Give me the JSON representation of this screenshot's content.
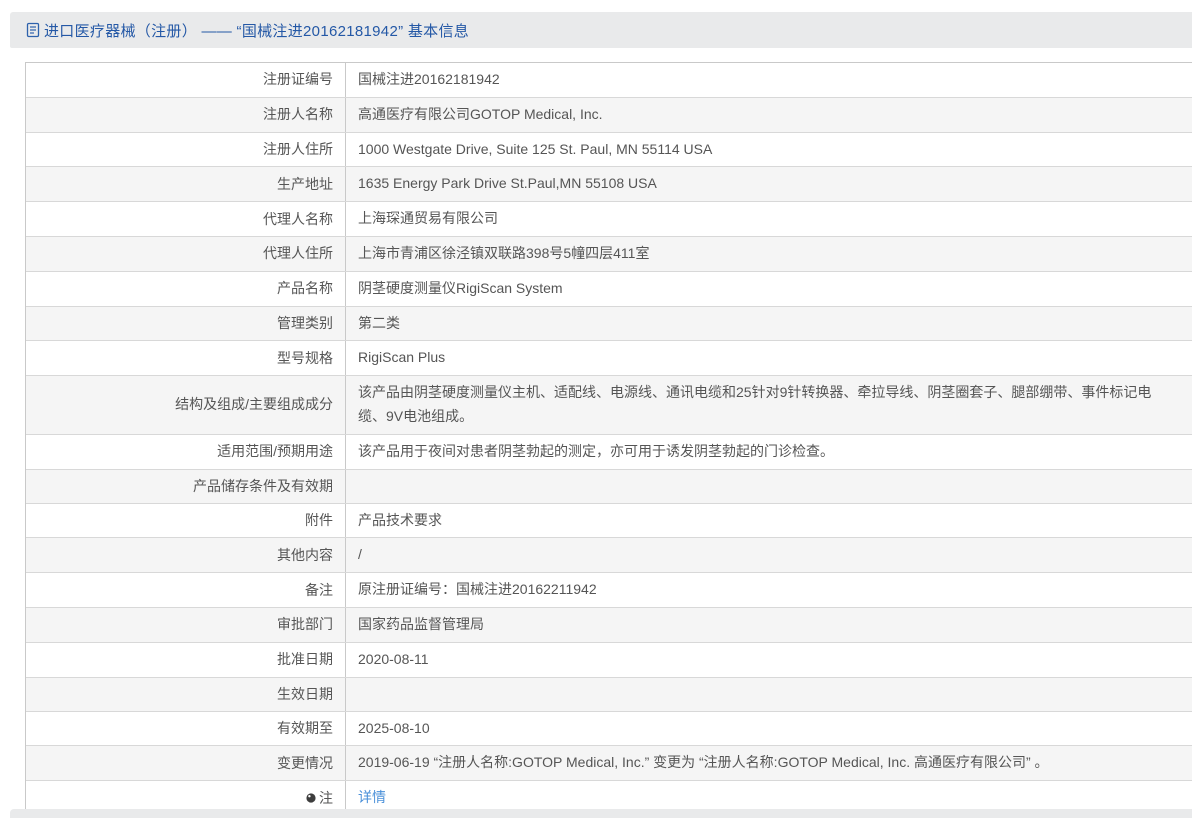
{
  "header": {
    "icon": "document-icon",
    "title": "进口医疗器械（注册） —— “国械注进20162181942” 基本信息"
  },
  "table": {
    "rows": [
      {
        "label": "注册证编号",
        "value": "国械注进20162181942"
      },
      {
        "label": "注册人名称",
        "value": "高通医疗有限公司GOTOP Medical, Inc."
      },
      {
        "label": "注册人住所",
        "value": "1000 Westgate Drive, Suite 125 St. Paul, MN 55114 USA"
      },
      {
        "label": "生产地址",
        "value": "1635 Energy Park Drive St.Paul,MN 55108 USA"
      },
      {
        "label": "代理人名称",
        "value": "上海琛通贸易有限公司"
      },
      {
        "label": "代理人住所",
        "value": "上海市青浦区徐泾镇双联路398号5幢四层411室"
      },
      {
        "label": "产品名称",
        "value": "阴茎硬度测量仪RigiScan System"
      },
      {
        "label": "管理类别",
        "value": "第二类"
      },
      {
        "label": "型号规格",
        "value": "RigiScan Plus"
      },
      {
        "label": "结构及组成/主要组成成分",
        "value": "该产品由阴茎硬度测量仪主机、适配线、电源线、通讯电缆和25针对9针转换器、牵拉导线、阴茎圈套子、腿部绷带、事件标记电缆、9V电池组成。"
      },
      {
        "label": "适用范围/预期用途",
        "value": "该产品用于夜间对患者阴茎勃起的测定，亦可用于诱发阴茎勃起的门诊检查。"
      },
      {
        "label": "产品储存条件及有效期",
        "value": ""
      },
      {
        "label": "附件",
        "value": "产品技术要求"
      },
      {
        "label": "其他内容",
        "value": "/"
      },
      {
        "label": "备注",
        "value": "原注册证编号：国械注进20162211942"
      },
      {
        "label": "审批部门",
        "value": "国家药品监督管理局"
      },
      {
        "label": "批准日期",
        "value": "2020-08-11"
      },
      {
        "label": "生效日期",
        "value": ""
      },
      {
        "label": "有效期至",
        "value": "2025-08-10"
      },
      {
        "label": "变更情况",
        "value": "2019-06-19 “注册人名称:GOTOP Medical, Inc.” 变更为 “注册人名称:GOTOP Medical, Inc. 高通医疗有限公司” 。"
      },
      {
        "label": "注",
        "label_icon": "note-icon",
        "value": "详情",
        "value_is_link": true
      }
    ]
  },
  "colors": {
    "header_bar_bg": "#e9eaeb",
    "header_title": "#2458a6",
    "link": "#4a90d9",
    "zebra_row_bg": "#f5f5f5",
    "cell_text": "#555555",
    "table_border": "#c9c9c9"
  }
}
